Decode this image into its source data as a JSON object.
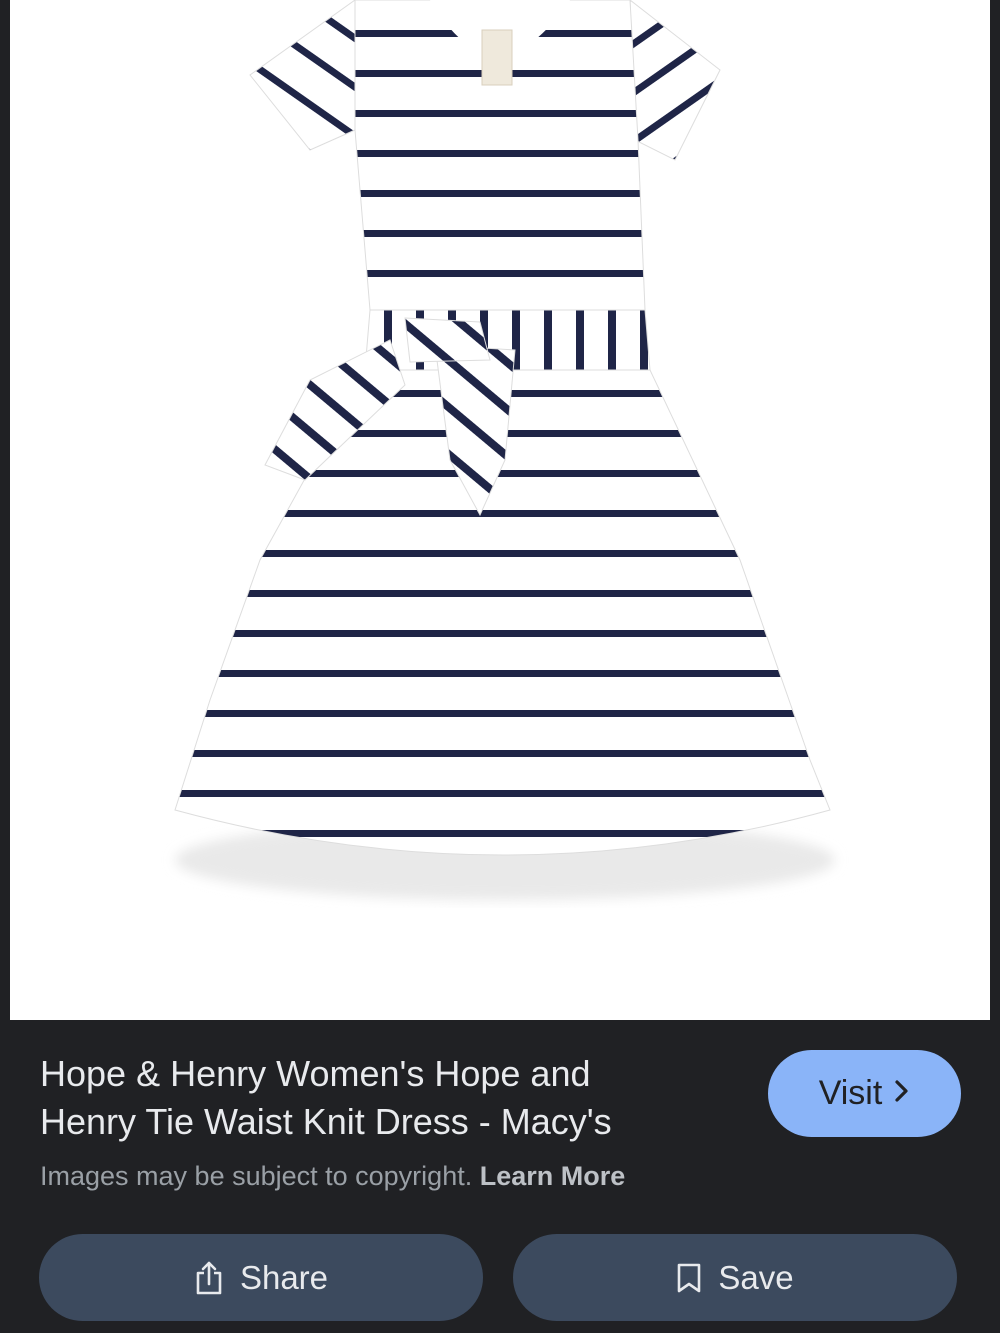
{
  "result": {
    "title_line1": "Hope & Henry Women's Hope and",
    "title_line2": "Henry Tie Waist Knit Dress - Macy's",
    "copyright_text": "Images may be subject to copyright.",
    "learn_more": "Learn More"
  },
  "buttons": {
    "visit_label": "Visit",
    "share_label": "Share",
    "save_label": "Save"
  },
  "icons": {
    "visit": "chevron-right-icon",
    "share": "share-icon",
    "save": "bookmark-icon"
  },
  "colors": {
    "background": "#202124",
    "visit_button": "#8ab4f8",
    "action_button": "#3c4a5e",
    "stripe": "#1f2547"
  }
}
